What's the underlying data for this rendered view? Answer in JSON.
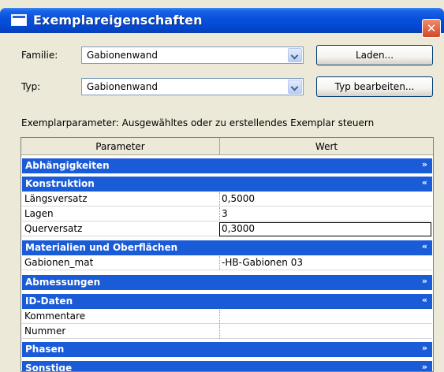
{
  "window": {
    "title": "Exemplareigenschaften",
    "close_glyph": "✕"
  },
  "familie": {
    "label": "Familie:",
    "value": "Gabionenwand"
  },
  "typ": {
    "label": "Typ:",
    "value": "Gabionenwand"
  },
  "buttons": {
    "laden": "Laden...",
    "typ_bearbeiten": "Typ bearbeiten..."
  },
  "hint": "Exemplarparameter: Ausgewähltes oder zu erstellendes Exemplar steuern",
  "grid": {
    "columns": [
      "Parameter",
      "Wert"
    ],
    "groups": {
      "abhaengigkeiten": {
        "label": "Abhängigkeiten",
        "chevron": "»"
      },
      "konstruktion": {
        "label": "Konstruktion",
        "chevron": "«"
      },
      "materialien": {
        "label": "Materialien und Oberflächen",
        "chevron": "«"
      },
      "abmessungen": {
        "label": "Abmessungen",
        "chevron": "»"
      },
      "id_daten": {
        "label": "ID-Daten",
        "chevron": "«"
      },
      "phasen": {
        "label": "Phasen",
        "chevron": "»"
      },
      "sonstige": {
        "label": "Sonstige",
        "chevron": "»"
      }
    },
    "rows": {
      "laengsversatz": {
        "param": "Längsversatz",
        "value": "0,5000"
      },
      "lagen": {
        "param": "Lagen",
        "value": "3"
      },
      "querversatz": {
        "param": "Querversatz",
        "value": "0,3000"
      },
      "gabionen_mat": {
        "param": "Gabionen_mat",
        "value": "-HB-Gabionen 03"
      },
      "kommentare": {
        "param": "Kommentare",
        "value": ""
      },
      "nummer": {
        "param": "Nummer",
        "value": ""
      }
    }
  },
  "colors": {
    "group_header": "#1a5bd8",
    "titlebar": "#0a52dc",
    "dialog_bg": "#ece9d8"
  },
  "icons": {
    "window_icon": "window-icon",
    "close": "close-icon",
    "dropdown": "chevron-down-icon"
  }
}
